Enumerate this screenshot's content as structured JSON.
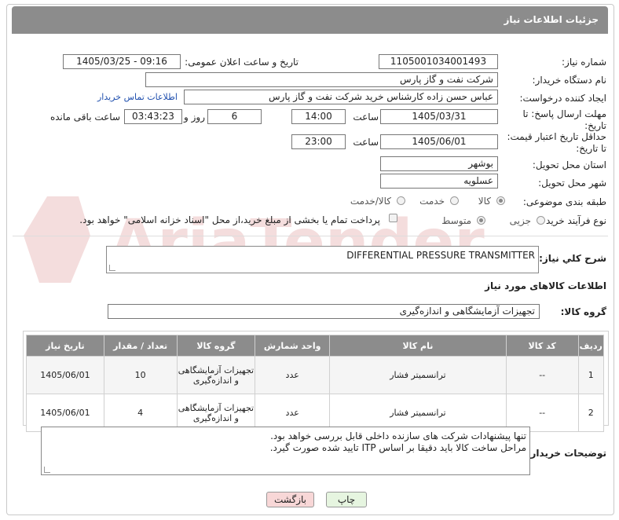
{
  "header": {
    "title": "جزئیات اطلاعات نیاز"
  },
  "fields": {
    "need_number_label": "شماره نیاز:",
    "need_number": "1105001034001493",
    "announce_label": "تاریخ و ساعت اعلان عمومی:",
    "announce_value": "1405/03/25 - 09:16",
    "buyer_org_label": "نام دستگاه خریدار:",
    "buyer_org": "شرکت نفت و گاز پارس",
    "creator_label": "ایجاد کننده درخواست:",
    "creator": "عباس حسن زاده کارشناس خرید شرکت نفت و گاز پارس",
    "contact_link": "اطلاعات تماس خریدار",
    "deadline_label_1": "مهلت ارسال پاسخ: تا",
    "deadline_label_2": "تاریخ:",
    "deadline_date": "1405/03/31",
    "time_label": "ساعت",
    "deadline_time": "14:00",
    "days_value": "6",
    "days_label": "روز و",
    "remaining_time": "03:43:23",
    "remaining_label": "ساعت باقی مانده",
    "validity_label_1": "حداقل تاریخ اعتبار قیمت:",
    "validity_label_2": "تا تاریخ:",
    "validity_date": "1405/06/01",
    "validity_time": "23:00",
    "province_label": "استان محل تحویل:",
    "province": "بوشهر",
    "city_label": "شهر محل تحویل:",
    "city": "عسلویه",
    "category_label": "طبقه بندی موضوعی:",
    "category_options": [
      "کالا",
      "خدمت",
      "کالا/خدمت"
    ],
    "purchase_type_label": "نوع فرآیند خرید :",
    "purchase_options": [
      "جزیی",
      "متوسط"
    ],
    "payment_note": "پرداخت تمام یا بخشی از مبلغ خرید،از محل \"اسناد خزانه اسلامی\" خواهد بود."
  },
  "description": {
    "label": "شرح کلي نياز:",
    "value": "DIFFERENTIAL PRESSURE TRANSMITTER"
  },
  "goods_section": {
    "title": "اطلاعات کالاهای مورد نیاز",
    "group_label": "گروه کالا:",
    "group_value": "تجهیزات آزمایشگاهی و اندازه‌گیری"
  },
  "table": {
    "headers": [
      "ردیف",
      "کد کالا",
      "نام کالا",
      "واحد شمارش",
      "گروه کالا",
      "تعداد / مقدار",
      "تاریخ نیاز"
    ],
    "rows": [
      {
        "row": "1",
        "code": "--",
        "name": "ترانسمیتر فشار",
        "unit": "عدد",
        "group": "تجهیزات آزمایشگاهی و اندازه‌گیری",
        "qty": "10",
        "date": "1405/06/01"
      },
      {
        "row": "2",
        "code": "--",
        "name": "ترانسمیتر فشار",
        "unit": "عدد",
        "group": "تجهیزات آزمایشگاهی و اندازه‌گیری",
        "qty": "4",
        "date": "1405/06/01"
      }
    ]
  },
  "buyer_notes": {
    "label": "توضیحات خریدار:",
    "line1": "تنها پیشنهادات شرکت های سازنده داخلی قابل بررسی خواهد بود.",
    "line2": "مراحل ساخت کالا باید دقیقا بر اساس ITP تایید شده صورت گیرد."
  },
  "buttons": {
    "print": "چاپ",
    "back": "بازگشت"
  },
  "watermark": {
    "text": "AriaTender.neT"
  },
  "colors": {
    "header_bg": "#8c8c8c",
    "link": "#1f4fae",
    "back_button_bg": "#f8d7d7",
    "print_button_bg": "#e6f5e0"
  }
}
